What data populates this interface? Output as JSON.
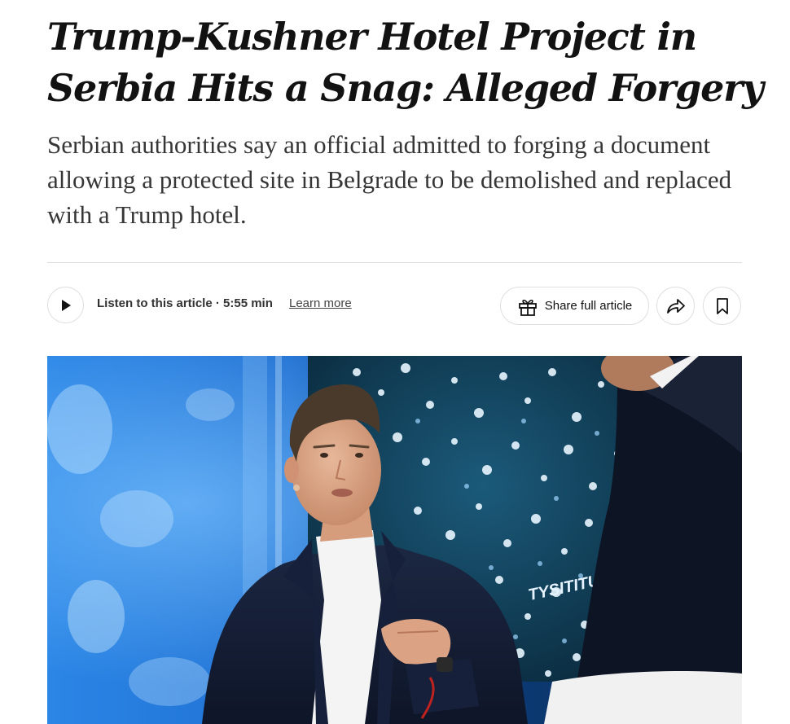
{
  "article": {
    "headline": "Trump-Kushner Hotel Project in Serbia Hits a Snag: Alleged Forgery",
    "summary": "Serbian authorities say an official admitted to forging a document allowing a protected site in Belgrade to be demolished and replaced with a Trump hotel."
  },
  "toolbar": {
    "listen_label": "Listen to this article · 5:55 min",
    "learn_more": "Learn more",
    "share_label": "Share full article"
  },
  "photo": {
    "backdrop_logo": "TYSITITUTE"
  },
  "icons": {
    "play": "play-icon",
    "gift": "gift-icon",
    "share": "share-forward-icon",
    "bookmark": "bookmark-icon"
  },
  "colors": {
    "text": "#121212",
    "dek": "#363636",
    "border": "#dfdfdf",
    "stage_blue": "#1f6fd1"
  }
}
